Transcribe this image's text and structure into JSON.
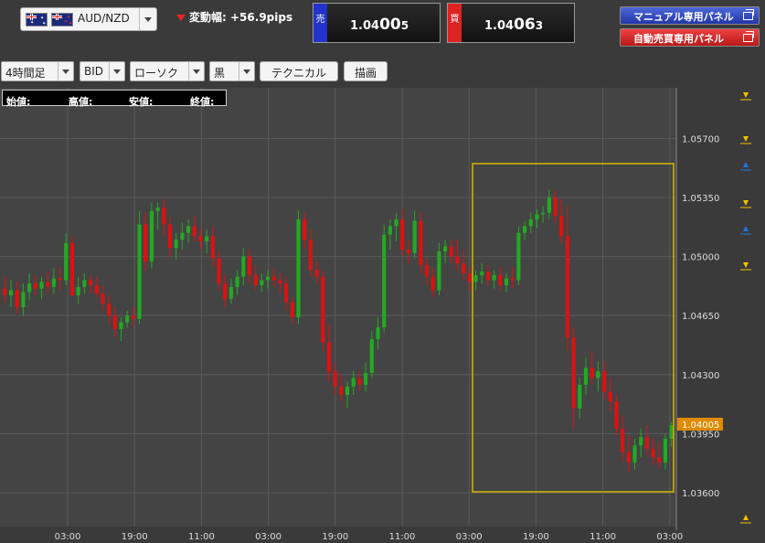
{
  "header": {
    "pair": "AUD/NZD",
    "change_label": "変動幅:",
    "change_value": "+56.9pips",
    "sell": {
      "tag": "売",
      "prefix": "1.04",
      "big": "00",
      "suffix": "5",
      "color": "#2233cc"
    },
    "buy": {
      "tag": "買",
      "prefix": "1.04",
      "big": "06",
      "suffix": "3",
      "color": "#dd2222"
    },
    "manual_panel_label": "マニュアル専用パネル",
    "auto_panel_label": "自動売買専用パネル"
  },
  "toolbar": {
    "timeframe": "4時間足",
    "price_type": "BID",
    "chart_type": "ローソク",
    "theme": "黒",
    "technical_label": "テクニカル",
    "draw_label": "描画"
  },
  "ohlc": {
    "open_label": "始値:",
    "open_value": "-",
    "high_label": "高値:",
    "high_value": "-",
    "low_label": "安値:",
    "low_value": "-",
    "close_label": "終値:",
    "close_value": "-"
  },
  "chart_data": {
    "type": "candlestick",
    "y_ticks": [
      "1.05700",
      "1.05350",
      "1.05000",
      "1.04650",
      "1.04300",
      "1.03950",
      "1.03600"
    ],
    "ylim": [
      1.034,
      1.06
    ],
    "x_ticks": [
      "03:00",
      "19:00",
      "11:00",
      "03:00",
      "19:00",
      "11:00",
      "03:00",
      "19:00",
      "11:00",
      "03:00"
    ],
    "current_price": "1.04005",
    "colors": {
      "up": "#22aa22",
      "down": "#dd1111",
      "highlight": "#d4b800",
      "price_tag": "#e08a00"
    },
    "candles": [
      [
        1.0481,
        1.0488,
        1.0473,
        1.0477
      ],
      [
        1.0477,
        1.0486,
        1.047,
        1.048
      ],
      [
        1.048,
        1.0485,
        1.0466,
        1.047
      ],
      [
        1.047,
        1.0484,
        1.0465,
        1.0479
      ],
      [
        1.0479,
        1.049,
        1.0474,
        1.0484
      ],
      [
        1.0484,
        1.0489,
        1.0477,
        1.0481
      ],
      [
        1.0481,
        1.0488,
        1.0475,
        1.0485
      ],
      [
        1.0485,
        1.0491,
        1.0478,
        1.0482
      ],
      [
        1.0482,
        1.0493,
        1.0478,
        1.0487
      ],
      [
        1.0487,
        1.0494,
        1.048,
        1.0486
      ],
      [
        1.0486,
        1.0514,
        1.0483,
        1.0508
      ],
      [
        1.0508,
        1.0512,
        1.0483,
        1.0477
      ],
      [
        1.0477,
        1.0488,
        1.0472,
        1.0482
      ],
      [
        1.0482,
        1.049,
        1.0478,
        1.0486
      ],
      [
        1.0486,
        1.0489,
        1.0478,
        1.0483
      ],
      [
        1.0483,
        1.0488,
        1.0476,
        1.0478
      ],
      [
        1.0478,
        1.0483,
        1.0468,
        1.0472
      ],
      [
        1.0472,
        1.0477,
        1.046,
        1.0465
      ],
      [
        1.0465,
        1.047,
        1.0452,
        1.0457
      ],
      [
        1.0457,
        1.0464,
        1.045,
        1.0461
      ],
      [
        1.0461,
        1.0468,
        1.0458,
        1.0465
      ],
      [
        1.0465,
        1.047,
        1.0459,
        1.0463
      ],
      [
        1.0463,
        1.0527,
        1.046,
        1.0519
      ],
      [
        1.0519,
        1.0526,
        1.0492,
        1.0497
      ],
      [
        1.0497,
        1.0532,
        1.0493,
        1.0527
      ],
      [
        1.0527,
        1.0532,
        1.0516,
        1.0529
      ],
      [
        1.0529,
        1.0534,
        1.0512,
        1.0519
      ],
      [
        1.0519,
        1.0523,
        1.05,
        1.0505
      ],
      [
        1.0505,
        1.0514,
        1.0498,
        1.051
      ],
      [
        1.051,
        1.052,
        1.0504,
        1.0514
      ],
      [
        1.0514,
        1.0522,
        1.0508,
        1.0518
      ],
      [
        1.0518,
        1.0524,
        1.0509,
        1.0512
      ],
      [
        1.0512,
        1.0516,
        1.0504,
        1.0509
      ],
      [
        1.0509,
        1.0516,
        1.0502,
        1.0512
      ],
      [
        1.0512,
        1.0518,
        1.0494,
        1.0499
      ],
      [
        1.0499,
        1.0503,
        1.048,
        1.0484
      ],
      [
        1.0484,
        1.0489,
        1.047,
        1.0475
      ],
      [
        1.0475,
        1.0487,
        1.0472,
        1.0482
      ],
      [
        1.0482,
        1.0492,
        1.0477,
        1.0488
      ],
      [
        1.0488,
        1.0505,
        1.0483,
        1.05
      ],
      [
        1.05,
        1.0504,
        1.0484,
        1.0489
      ],
      [
        1.0489,
        1.0495,
        1.048,
        1.0483
      ],
      [
        1.0483,
        1.049,
        1.0479,
        1.0486
      ],
      [
        1.0486,
        1.0492,
        1.0481,
        1.0488
      ],
      [
        1.0488,
        1.0493,
        1.0482,
        1.0486
      ],
      [
        1.0486,
        1.049,
        1.0478,
        1.0484
      ],
      [
        1.0484,
        1.0488,
        1.0468,
        1.0473
      ],
      [
        1.0473,
        1.0476,
        1.046,
        1.0464
      ],
      [
        1.0464,
        1.0527,
        1.046,
        1.0522
      ],
      [
        1.0522,
        1.0526,
        1.0504,
        1.051
      ],
      [
        1.051,
        1.0516,
        1.0488,
        1.0492
      ],
      [
        1.0492,
        1.0497,
        1.0484,
        1.0488
      ],
      [
        1.0488,
        1.0492,
        1.0444,
        1.0449
      ],
      [
        1.0449,
        1.046,
        1.0426,
        1.0432
      ],
      [
        1.0432,
        1.0437,
        1.0418,
        1.0423
      ],
      [
        1.0423,
        1.043,
        1.0414,
        1.0418
      ],
      [
        1.0418,
        1.0426,
        1.041,
        1.0423
      ],
      [
        1.0423,
        1.0432,
        1.0418,
        1.0428
      ],
      [
        1.0428,
        1.0432,
        1.042,
        1.0424
      ],
      [
        1.0424,
        1.0437,
        1.042,
        1.0431
      ],
      [
        1.0431,
        1.0456,
        1.0428,
        1.0451
      ],
      [
        1.0451,
        1.0464,
        1.0445,
        1.0458
      ],
      [
        1.0458,
        1.0519,
        1.0455,
        1.0513
      ],
      [
        1.0513,
        1.0522,
        1.0504,
        1.0518
      ],
      [
        1.0518,
        1.0526,
        1.0509,
        1.0522
      ],
      [
        1.0522,
        1.0528,
        1.05,
        1.0504
      ],
      [
        1.0504,
        1.051,
        1.0496,
        1.0502
      ],
      [
        1.0502,
        1.0527,
        1.0499,
        1.0521
      ],
      [
        1.0521,
        1.0526,
        1.049,
        1.0495
      ],
      [
        1.0495,
        1.0499,
        1.0483,
        1.0488
      ],
      [
        1.0488,
        1.0493,
        1.0476,
        1.048
      ],
      [
        1.048,
        1.0508,
        1.0477,
        1.0503
      ],
      [
        1.0503,
        1.051,
        1.0496,
        1.0506
      ],
      [
        1.0506,
        1.051,
        1.0496,
        1.05
      ],
      [
        1.05,
        1.051,
        1.0492,
        1.0496
      ],
      [
        1.0496,
        1.0504,
        1.0486,
        1.049
      ],
      [
        1.049,
        1.0494,
        1.048,
        1.0485
      ],
      [
        1.0485,
        1.0492,
        1.048,
        1.0489
      ],
      [
        1.0489,
        1.0496,
        1.0484,
        1.0491
      ],
      [
        1.0491,
        1.0495,
        1.0483,
        1.0486
      ],
      [
        1.0486,
        1.0492,
        1.0481,
        1.0489
      ],
      [
        1.0489,
        1.0494,
        1.048,
        1.0483
      ],
      [
        1.0483,
        1.049,
        1.0479,
        1.0487
      ],
      [
        1.0487,
        1.0494,
        1.0481,
        1.0486
      ],
      [
        1.0486,
        1.0518,
        1.0483,
        1.0514
      ],
      [
        1.0514,
        1.0521,
        1.051,
        1.0518
      ],
      [
        1.0518,
        1.0526,
        1.0514,
        1.0522
      ],
      [
        1.0522,
        1.0528,
        1.0517,
        1.0525
      ],
      [
        1.0525,
        1.053,
        1.052,
        1.0526
      ],
      [
        1.0526,
        1.054,
        1.0522,
        1.0535
      ],
      [
        1.0535,
        1.0539,
        1.052,
        1.0524
      ],
      [
        1.0524,
        1.0534,
        1.0508,
        1.0512
      ],
      [
        1.0512,
        1.053,
        1.0444,
        1.0452
      ],
      [
        1.0452,
        1.0458,
        1.0398,
        1.041
      ],
      [
        1.041,
        1.0428,
        1.0404,
        1.0424
      ],
      [
        1.0424,
        1.044,
        1.0418,
        1.0434
      ],
      [
        1.0434,
        1.0444,
        1.0424,
        1.0428
      ],
      [
        1.0428,
        1.0438,
        1.042,
        1.0432
      ],
      [
        1.0432,
        1.0438,
        1.0416,
        1.042
      ],
      [
        1.042,
        1.0428,
        1.0408,
        1.0414
      ],
      [
        1.0414,
        1.0418,
        1.0394,
        1.0398
      ],
      [
        1.0398,
        1.0406,
        1.0378,
        1.0384
      ],
      [
        1.0384,
        1.0394,
        1.0372,
        1.0378
      ],
      [
        1.0378,
        1.0392,
        1.0374,
        1.0388
      ],
      [
        1.0388,
        1.0398,
        1.0381,
        1.0393
      ],
      [
        1.0393,
        1.04,
        1.0382,
        1.0386
      ],
      [
        1.0386,
        1.0392,
        1.0376,
        1.0381
      ],
      [
        1.0381,
        1.039,
        1.0374,
        1.0378
      ],
      [
        1.0378,
        1.0395,
        1.0374,
        1.0392
      ],
      [
        1.0392,
        1.0402,
        1.0387,
        1.04
      ]
    ]
  }
}
